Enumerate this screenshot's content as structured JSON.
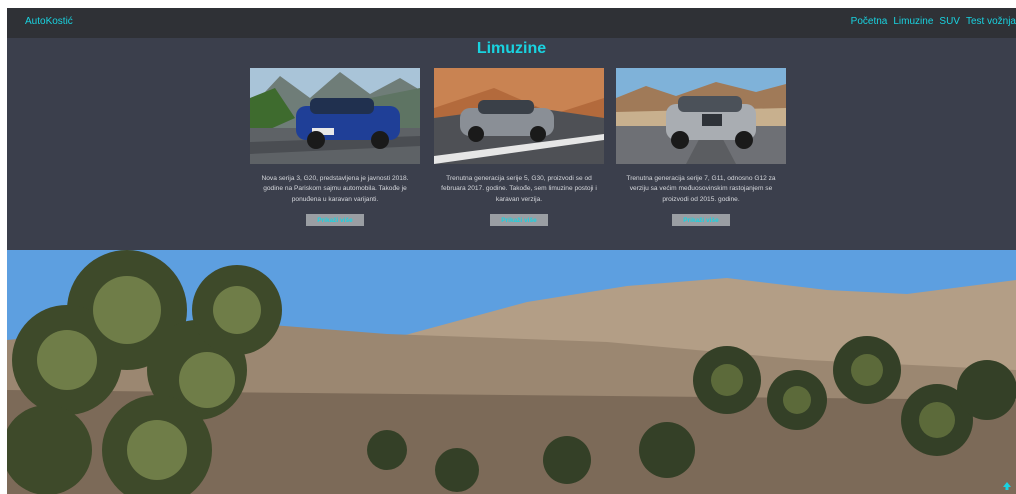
{
  "navbar": {
    "brand": "AutoKostić",
    "links": [
      {
        "label": "Početna"
      },
      {
        "label": "Limuzine"
      },
      {
        "label": "SUV"
      },
      {
        "label": "Test vožnja"
      }
    ]
  },
  "page": {
    "title": "Limuzine"
  },
  "cards": [
    {
      "text": "Nova serija 3, G20, predstavljena je javnosti 2018. godine na Pariskom sajmu automobila. Takođe je ponuđena u karavan varijanti.",
      "button_label": "Prikaži više",
      "car_color": "#1f3f97"
    },
    {
      "text": "Trenutna generacija serije 5, G30, proizvodi se od februara 2017. godine. Takođe, sem limuzine postoji i karavan verzija.",
      "button_label": "Prikaži više",
      "car_color": "#8a8f96"
    },
    {
      "text": "Trenutna generacija serije 7, G11, odnosno G12 za verziju sa većim međuosovinskim rastojanjem se proizvodi od 2015. godine.",
      "button_label": "Prikaži više",
      "car_color": "#a9adb2"
    }
  ],
  "colors": {
    "navbar_bg": "#2f3136",
    "content_bg": "#3b3f4c",
    "accent": "#19d3e0",
    "button_bg": "#9a9ea3"
  },
  "icons": {
    "scroll_top": "arrow-up-icon"
  }
}
